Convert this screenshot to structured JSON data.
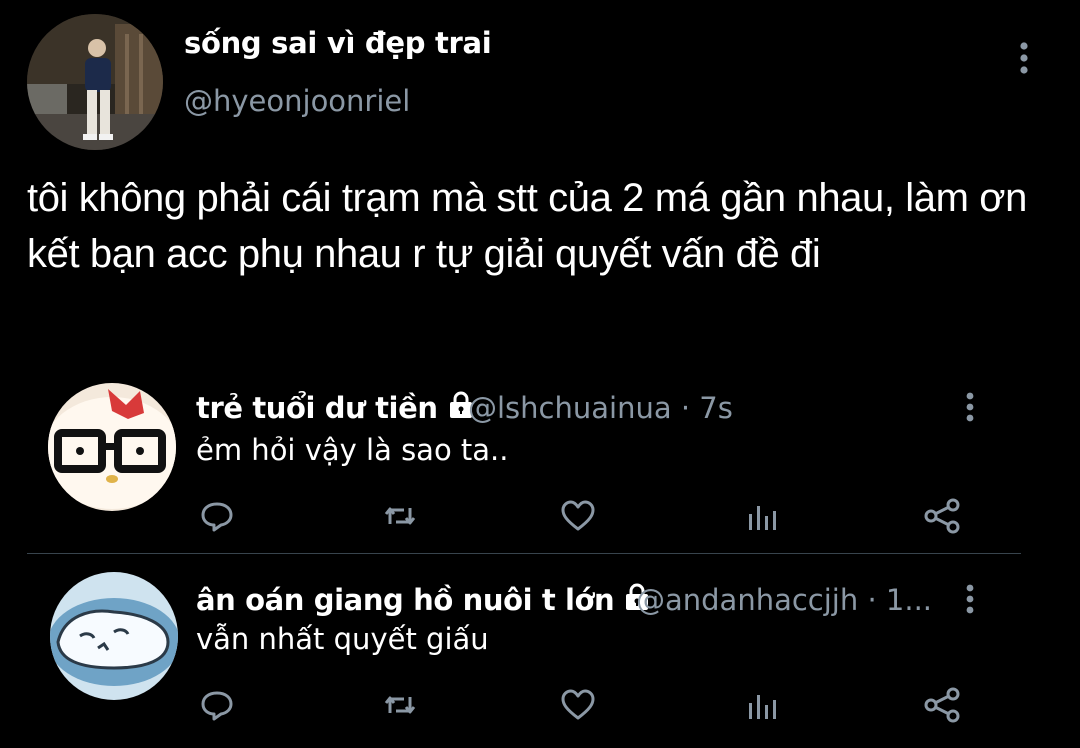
{
  "tweet": {
    "author_name": "sống sai vì đẹp trai",
    "author_handle": "@hyeonjoonriel",
    "text": "tôi không phải cái trạm mà stt của 2 má gần nhau, làm ơn kết bạn acc phụ nhau r tự giải quyết vấn đề đi"
  },
  "replies": [
    {
      "name": "trẻ tuổi dư tiền",
      "handle": "@lshchuainua · 7s",
      "text": "ẻm hỏi vậy là sao ta..",
      "locked": true
    },
    {
      "name": "ân oán giang hồ nuôi t lớn",
      "handle": "@andanhaccjjh · 1...",
      "text": "vẫn nhất quyết giấu",
      "locked": true
    }
  ],
  "icons": {
    "more": "more-vertical-icon",
    "lock": "lock-icon",
    "reply": "reply-icon",
    "retweet": "retweet-icon",
    "like": "heart-icon",
    "analytics": "analytics-icon",
    "share": "share-icon"
  },
  "colors": {
    "background": "#000000",
    "text": "#ffffff",
    "secondary": "#8b98a5",
    "divider": "#38444d"
  }
}
